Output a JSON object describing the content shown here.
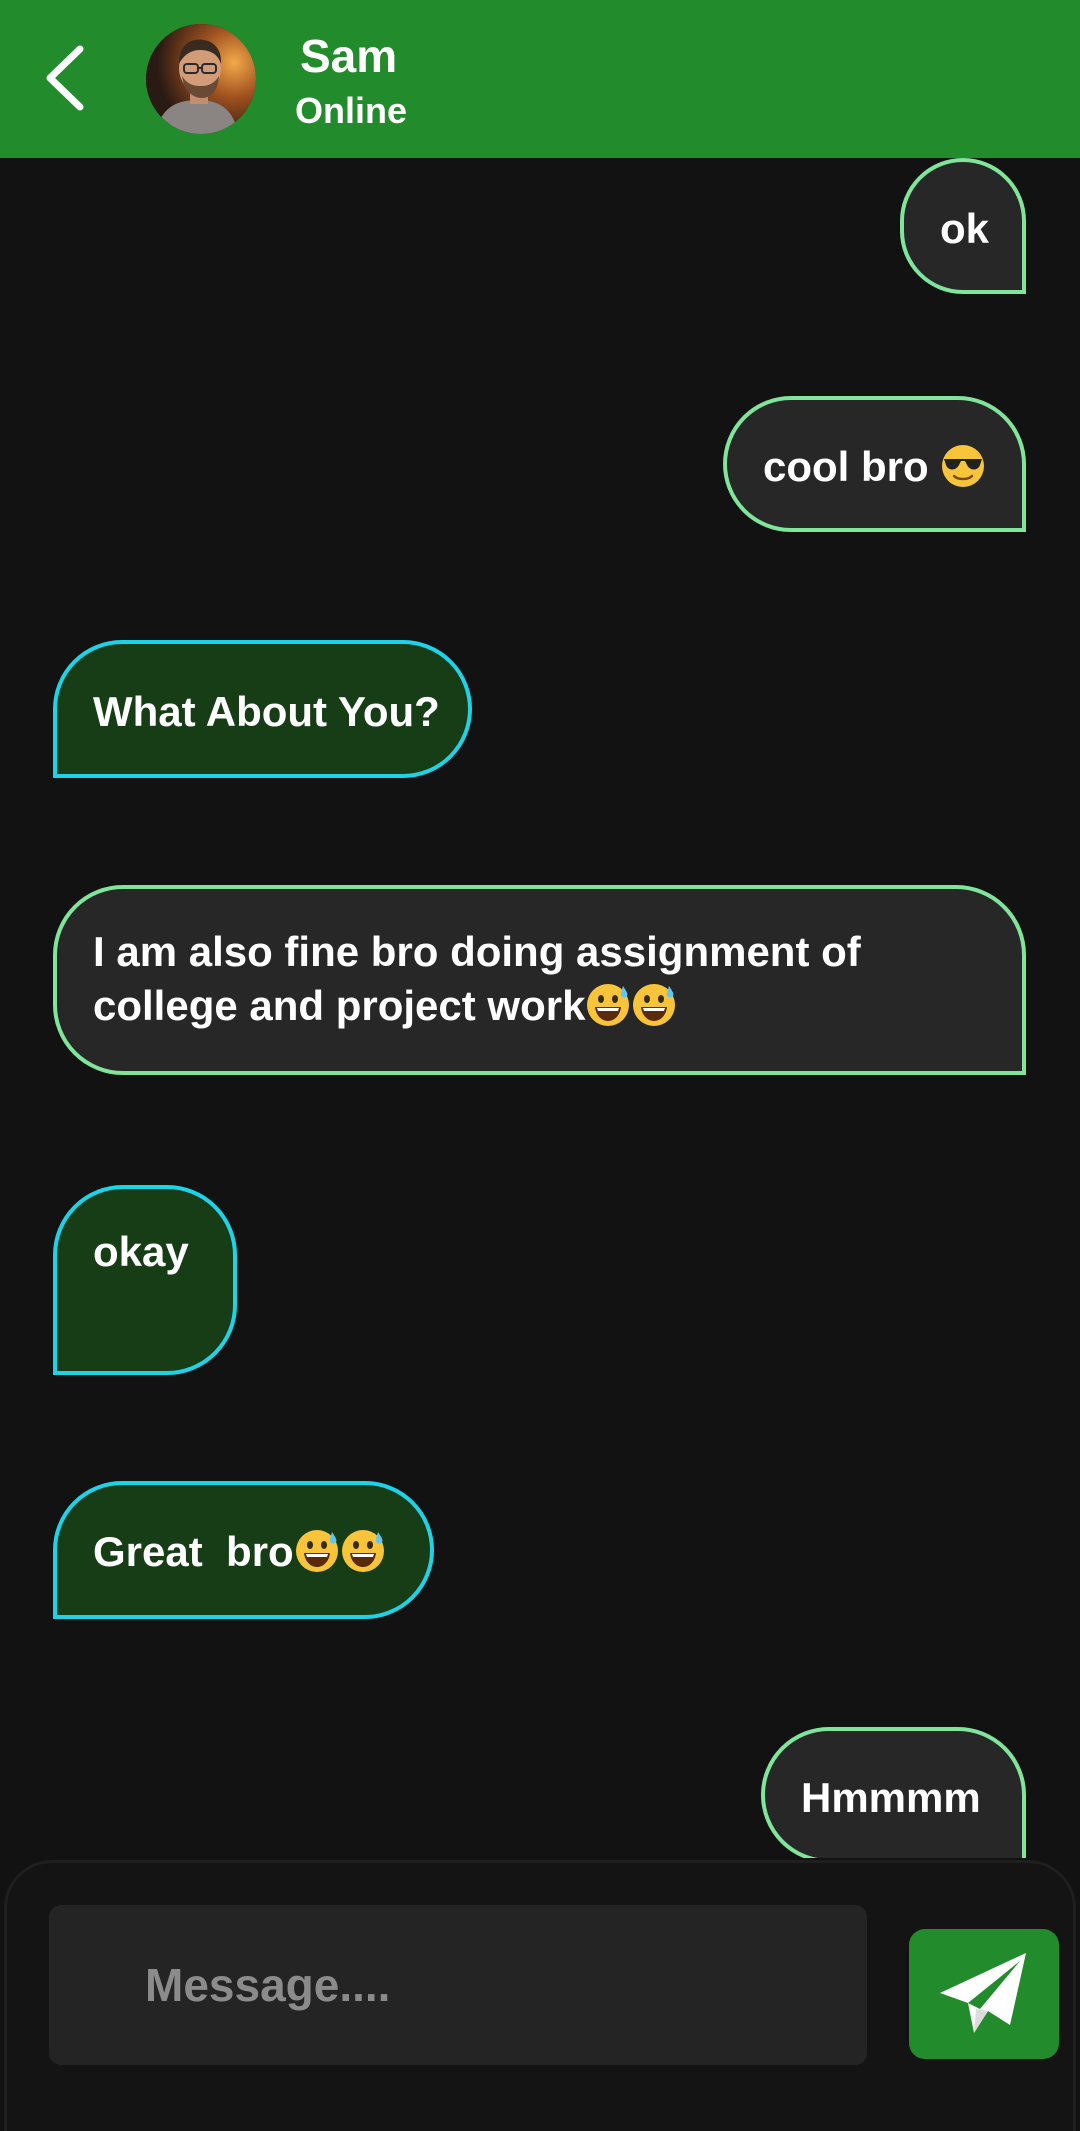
{
  "header": {
    "contact_name": "Sam",
    "status": "Online",
    "back_icon": "chevron-left-icon",
    "avatar": "contact-avatar-photo"
  },
  "messages": [
    {
      "direction": "sent",
      "text": "ok",
      "emoji": ""
    },
    {
      "direction": "sent",
      "text": "cool bro ",
      "emoji": "smiling-face-with-sunglasses"
    },
    {
      "direction": "received",
      "text": "What About You?",
      "emoji": ""
    },
    {
      "direction": "sent",
      "text": "I am also fine bro doing assignment of college and project work",
      "emoji": "grinning-face-with-sweat x2"
    },
    {
      "direction": "received",
      "text": "okay",
      "emoji": ""
    },
    {
      "direction": "received",
      "text": "Great  bro",
      "emoji": "grinning-face-with-sweat x2"
    },
    {
      "direction": "sent",
      "text": "Hmmmm",
      "emoji": ""
    }
  ],
  "composer": {
    "placeholder": "Message....",
    "send_icon": "paper-plane-icon"
  },
  "colors": {
    "header_bg": "#228b2b",
    "background": "#121212",
    "sent_bubble_bg": "#272727",
    "sent_bubble_border": "#7fe59a",
    "received_bubble_bg": "#163d16",
    "received_bubble_border": "#1ed2e8",
    "send_button_bg": "#228b2b"
  }
}
